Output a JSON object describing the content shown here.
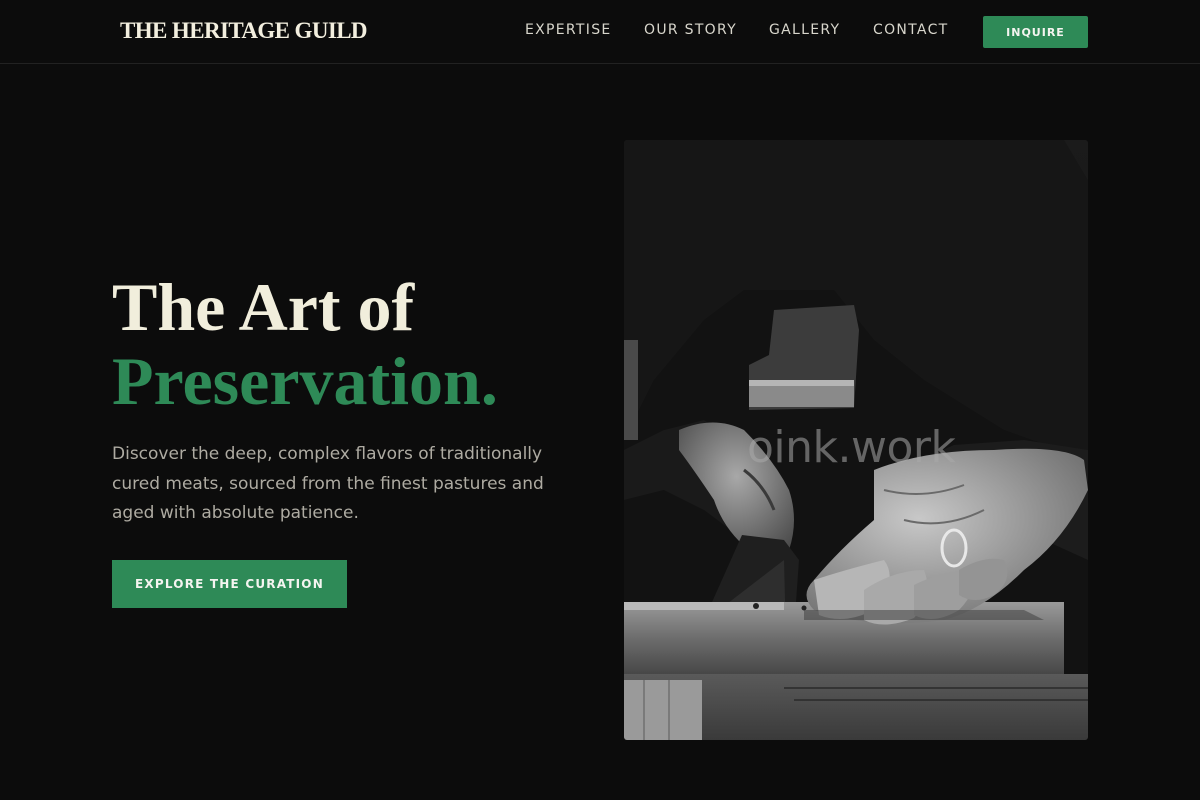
{
  "header": {
    "brand": "THE HERITAGE GUILD",
    "nav": [
      "EXPERTISE",
      "OUR STORY",
      "GALLERY",
      "CONTACT"
    ],
    "inquire_label": "INQUIRE"
  },
  "hero": {
    "title_line1": "The Art of",
    "title_line2": "Preservation.",
    "description": "Discover the deep, complex flavors of traditionally cured meats, sourced from the finest pastures and aged with absolute patience.",
    "cta_label": "EXPLORE THE CURATION",
    "image_watermark": "oink.work",
    "image_alt": "Black and white photo of hands sawing a wooden block"
  },
  "colors": {
    "background": "#0c0c0c",
    "accent": "#2e8a57",
    "title": "#f1eedc",
    "body_text": "#aeaba2"
  }
}
